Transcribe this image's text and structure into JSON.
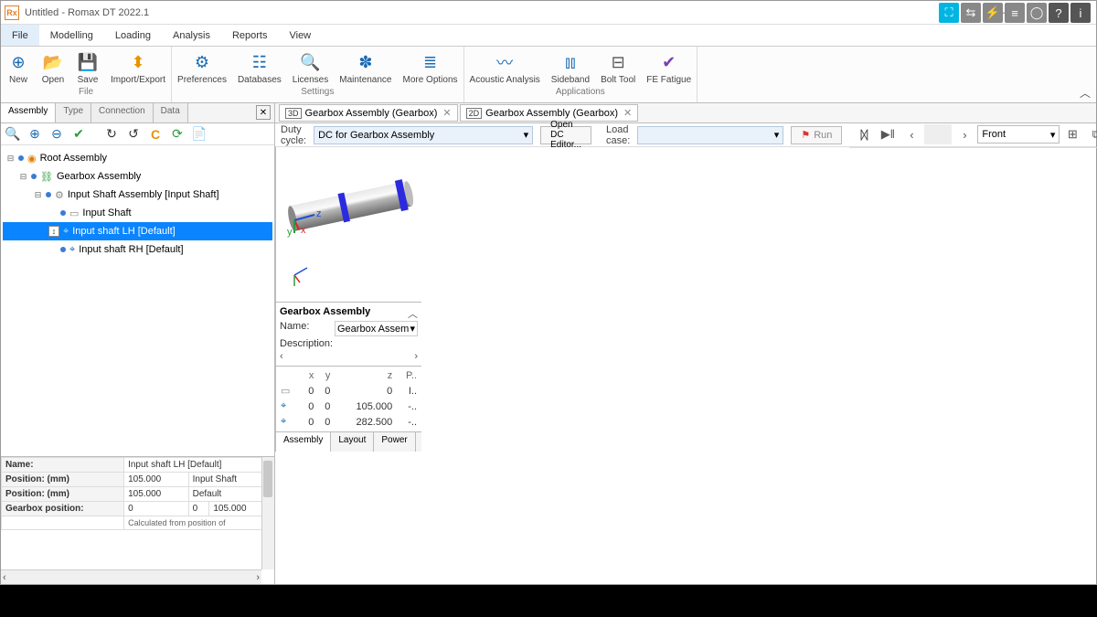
{
  "window": {
    "title": "Untitled -  Romax DT 2022.1"
  },
  "menu": {
    "items": [
      "File",
      "Modelling",
      "Loading",
      "Analysis",
      "Reports",
      "View"
    ],
    "active": 0
  },
  "ribbon": {
    "file": [
      {
        "label": "New",
        "icon": "＋",
        "color": "#1a6bb5"
      },
      {
        "label": "Open",
        "icon": "📂",
        "color": "#1a6bb5"
      },
      {
        "label": "Save",
        "icon": "💾",
        "color": "#1a6bb5"
      },
      {
        "label": "Import/Export",
        "icon": "⇵",
        "color": "#e69500"
      }
    ],
    "file_group": "File",
    "settings": [
      {
        "label": "Preferences",
        "icon": "⚙",
        "color": "#1a6bb5"
      },
      {
        "label": "Databases",
        "icon": "🗄",
        "color": "#1a6bb5"
      },
      {
        "label": "Licenses",
        "icon": "🔑",
        "color": "#1a6bb5"
      },
      {
        "label": "Maintenance",
        "icon": "🛠",
        "color": "#1a6bb5"
      },
      {
        "label": "More Options",
        "icon": "≣",
        "color": "#1a6bb5"
      }
    ],
    "settings_group": "Settings",
    "apps": [
      {
        "label": "Acoustic Analysis",
        "icon": "〰",
        "color": "#1a6bb5"
      },
      {
        "label": "Sideband",
        "icon": "📊",
        "color": "#1a6bb5"
      },
      {
        "label": "Bolt Tool",
        "icon": "🔩",
        "color": "#555"
      },
      {
        "label": "FE Fatigue",
        "icon": "✔",
        "color": "#7b3fb5"
      }
    ],
    "apps_group": "Applications"
  },
  "left_tabs": [
    "Assembly",
    "Type",
    "Connection",
    "Data"
  ],
  "tree": {
    "0": {
      "label": "Root Assembly"
    },
    "1": {
      "label": "Gearbox Assembly"
    },
    "2": {
      "label": "Input Shaft Assembly [Input Shaft]"
    },
    "3": {
      "label": "Input Shaft"
    },
    "4": {
      "label": "Input shaft LH [Default]"
    },
    "5": {
      "label": "Input shaft RH [Default]"
    }
  },
  "props": {
    "name_k": "Name:",
    "name_v": "Input shaft LH [Default]",
    "p1_k": "Position: (mm)",
    "p1_v": "105.000",
    "p1_r": "Input Shaft",
    "p2_k": "Position: (mm)",
    "p2_v": "105.000",
    "p2_r": "Default",
    "gp_k": "Gearbox position:",
    "gp_x": "0",
    "gp_y": "0",
    "gp_z": "105.000",
    "gp_r": "Calculated from position of"
  },
  "doctabs": {
    "0": {
      "badge": "3D",
      "label": "Gearbox Assembly (Gearbox)"
    },
    "1": {
      "badge": "2D",
      "label": "Gearbox Assembly (Gearbox)"
    }
  },
  "dutycycle": {
    "label": "Duty cycle:",
    "value": "DC for Gearbox Assembly",
    "open": "Open DC Editor...",
    "loadcase": "Load case:",
    "run": "Run"
  },
  "viewsel": "Front",
  "rpanel": {
    "heading": "Gearbox Assembly",
    "name_k": "Name:",
    "name_v": "Gearbox Assem",
    "desc_k": "Description:",
    "cols": {
      "x": "x",
      "y": "y",
      "z": "z",
      "p": "P.."
    },
    "rows": [
      {
        "x": "0",
        "y": "0",
        "z": "0",
        "p": "I.."
      },
      {
        "x": "0",
        "y": "0",
        "z": "105.000",
        "p": "-.."
      },
      {
        "x": "0",
        "y": "0",
        "z": "282.500",
        "p": "-.."
      }
    ],
    "tabs": [
      "Assembly",
      "Layout",
      "Power"
    ]
  }
}
